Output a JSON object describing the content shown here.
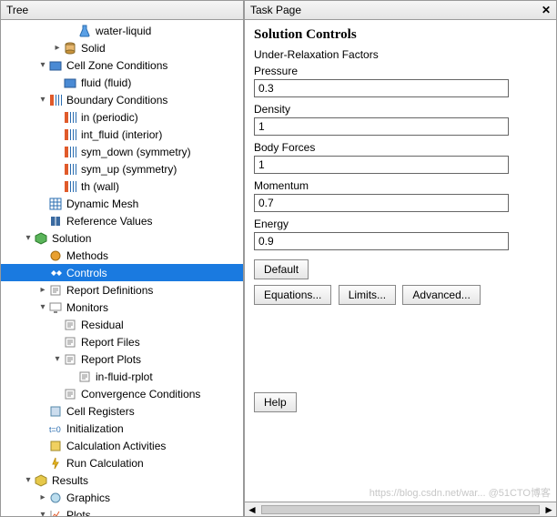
{
  "tree": {
    "title": "Tree",
    "nodes": [
      {
        "depth": 5,
        "arrow": "",
        "icon": "flask",
        "label": "water-liquid",
        "sel": false,
        "inter": true
      },
      {
        "depth": 4,
        "arrow": "right",
        "icon": "cylinder",
        "label": "Solid",
        "sel": false,
        "inter": true
      },
      {
        "depth": 3,
        "arrow": "down",
        "icon": "box-blue",
        "label": "Cell Zone Conditions",
        "sel": false,
        "inter": true
      },
      {
        "depth": 4,
        "arrow": "",
        "icon": "box-blue",
        "label": "fluid (fluid)",
        "sel": false,
        "inter": true
      },
      {
        "depth": 3,
        "arrow": "down",
        "icon": "boundary",
        "label": "Boundary Conditions",
        "sel": false,
        "inter": true
      },
      {
        "depth": 4,
        "arrow": "",
        "icon": "boundary",
        "label": "in (periodic)",
        "sel": false,
        "inter": true
      },
      {
        "depth": 4,
        "arrow": "",
        "icon": "boundary",
        "label": "int_fluid (interior)",
        "sel": false,
        "inter": true
      },
      {
        "depth": 4,
        "arrow": "",
        "icon": "boundary",
        "label": "sym_down (symmetry)",
        "sel": false,
        "inter": true
      },
      {
        "depth": 4,
        "arrow": "",
        "icon": "boundary",
        "label": "sym_up (symmetry)",
        "sel": false,
        "inter": true
      },
      {
        "depth": 4,
        "arrow": "",
        "icon": "boundary",
        "label": "th (wall)",
        "sel": false,
        "inter": true
      },
      {
        "depth": 3,
        "arrow": "",
        "icon": "mesh",
        "label": "Dynamic Mesh",
        "sel": false,
        "inter": true
      },
      {
        "depth": 3,
        "arrow": "",
        "icon": "book",
        "label": "Reference Values",
        "sel": false,
        "inter": true
      },
      {
        "depth": 2,
        "arrow": "down",
        "icon": "cube-green",
        "label": "Solution",
        "sel": false,
        "inter": true
      },
      {
        "depth": 3,
        "arrow": "",
        "icon": "methods",
        "label": "Methods",
        "sel": false,
        "inter": true
      },
      {
        "depth": 3,
        "arrow": "",
        "icon": "controls",
        "label": "Controls",
        "sel": true,
        "inter": true
      },
      {
        "depth": 3,
        "arrow": "right",
        "icon": "report",
        "label": "Report Definitions",
        "sel": false,
        "inter": true
      },
      {
        "depth": 3,
        "arrow": "down",
        "icon": "monitor",
        "label": "Monitors",
        "sel": false,
        "inter": true
      },
      {
        "depth": 4,
        "arrow": "",
        "icon": "report",
        "label": "Residual",
        "sel": false,
        "inter": true
      },
      {
        "depth": 4,
        "arrow": "",
        "icon": "report",
        "label": "Report Files",
        "sel": false,
        "inter": true
      },
      {
        "depth": 4,
        "arrow": "down",
        "icon": "report",
        "label": "Report Plots",
        "sel": false,
        "inter": true
      },
      {
        "depth": 5,
        "arrow": "",
        "icon": "report",
        "label": "in-fluid-rplot",
        "sel": false,
        "inter": true
      },
      {
        "depth": 4,
        "arrow": "",
        "icon": "report",
        "label": "Convergence Conditions",
        "sel": false,
        "inter": true
      },
      {
        "depth": 3,
        "arrow": "",
        "icon": "register",
        "label": "Cell Registers",
        "sel": false,
        "inter": true
      },
      {
        "depth": 3,
        "arrow": "",
        "icon": "init",
        "label": "Initialization",
        "sel": false,
        "inter": true
      },
      {
        "depth": 3,
        "arrow": "",
        "icon": "calc",
        "label": "Calculation Activities",
        "sel": false,
        "inter": true
      },
      {
        "depth": 3,
        "arrow": "",
        "icon": "run",
        "label": "Run Calculation",
        "sel": false,
        "inter": true
      },
      {
        "depth": 2,
        "arrow": "down",
        "icon": "cube-yellow",
        "label": "Results",
        "sel": false,
        "inter": true
      },
      {
        "depth": 3,
        "arrow": "right",
        "icon": "graphics",
        "label": "Graphics",
        "sel": false,
        "inter": true
      },
      {
        "depth": 3,
        "arrow": "down",
        "icon": "plots",
        "label": "Plots",
        "sel": false,
        "inter": true
      }
    ]
  },
  "task": {
    "title": "Task Page",
    "heading": "Solution Controls",
    "subheading": "Under-Relaxation Factors",
    "fields": [
      {
        "label": "Pressure",
        "value": "0.3"
      },
      {
        "label": "Density",
        "value": "1"
      },
      {
        "label": "Body Forces",
        "value": "1"
      },
      {
        "label": "Momentum",
        "value": "0.7"
      },
      {
        "label": "Energy",
        "value": "0.9"
      }
    ],
    "buttons": {
      "default": "Default",
      "equations": "Equations...",
      "limits": "Limits...",
      "advanced": "Advanced...",
      "help": "Help"
    }
  },
  "watermark": "https://blog.csdn.net/war... @51CTO博客"
}
